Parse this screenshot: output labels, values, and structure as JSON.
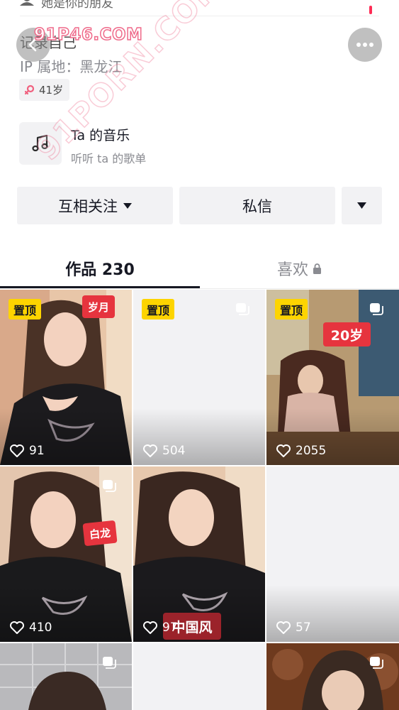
{
  "header": {
    "friend_text": "她是你的朋友",
    "watermark": "91P46.COM",
    "watermark_diag": "91PORN.COM"
  },
  "profile": {
    "bio": "记录自己",
    "ip_location": "IP 属地：黑龙江",
    "age": "41岁"
  },
  "music": {
    "title": "Ta 的音乐",
    "subtitle": "听听 ta 的歌单"
  },
  "actions": {
    "follow_label": "互相关注",
    "message_label": "私信"
  },
  "tabs": {
    "works_label": "作品 230",
    "likes_label": "喜欢"
  },
  "posts": [
    {
      "pinned": "置顶",
      "likes": "91",
      "sticker": "岁月"
    },
    {
      "pinned": "置顶",
      "likes": "504"
    },
    {
      "pinned": "置顶",
      "likes": "2055",
      "sticker": "20岁"
    },
    {
      "likes": "410",
      "sticker": "白龙"
    },
    {
      "likes": "97",
      "sticker": "中国风"
    },
    {
      "likes": "57"
    },
    {},
    {},
    {}
  ],
  "colors": {
    "accent": "#fe2c55",
    "pin_yellow": "#fdd400",
    "sticker_red": "#e6343e",
    "button_bg": "#f2f2f4",
    "text_primary": "#161823",
    "text_secondary": "#8a8b91"
  }
}
